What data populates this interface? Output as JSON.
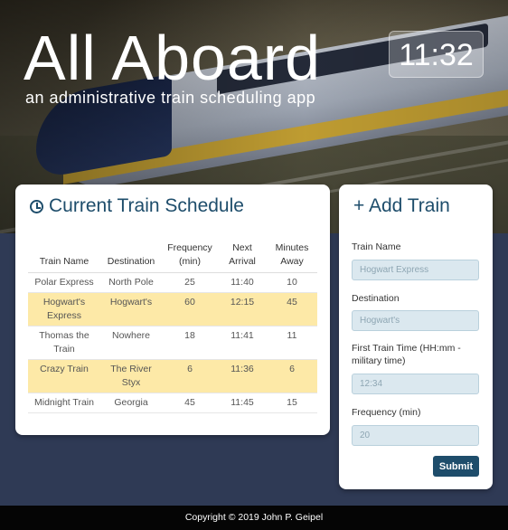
{
  "header": {
    "title": "All Aboard",
    "subtitle": "an administrative train scheduling app",
    "clock": "11:32"
  },
  "schedule": {
    "title": "Current Train Schedule",
    "icon": "clock-icon",
    "columns": [
      "Train Name",
      "Destination",
      "Frequency (min)",
      "Next Arrival",
      "Minutes Away"
    ],
    "rows": [
      [
        "Polar Express",
        "North Pole",
        "25",
        "11:40",
        "10"
      ],
      [
        "Hogwart's Express",
        "Hogwart's",
        "60",
        "12:15",
        "45"
      ],
      [
        "Thomas the Train",
        "Nowhere",
        "18",
        "11:41",
        "11"
      ],
      [
        "Crazy Train",
        "The River Styx",
        "6",
        "11:36",
        "6"
      ],
      [
        "Midnight Train",
        "Georgia",
        "45",
        "11:45",
        "15"
      ]
    ]
  },
  "add_train": {
    "title": "+ Add Train",
    "train_name_label": "Train Name",
    "train_name_placeholder": "Hogwart Express",
    "destination_label": "Destination",
    "destination_placeholder": "Hogwart's",
    "first_time_label": "First Train Time (HH:mm - military time)",
    "first_time_placeholder": "12:34",
    "frequency_label": "Frequency (min)",
    "frequency_placeholder": "20",
    "submit_label": "Submit"
  },
  "footer": {
    "copyright": "Copyright © 2019 John P. Geipel"
  },
  "colors": {
    "accent": "#1e4d6b",
    "background": "#2f3a55",
    "row_highlight": "#fde9a7",
    "input_bg": "#dbe8ef"
  }
}
